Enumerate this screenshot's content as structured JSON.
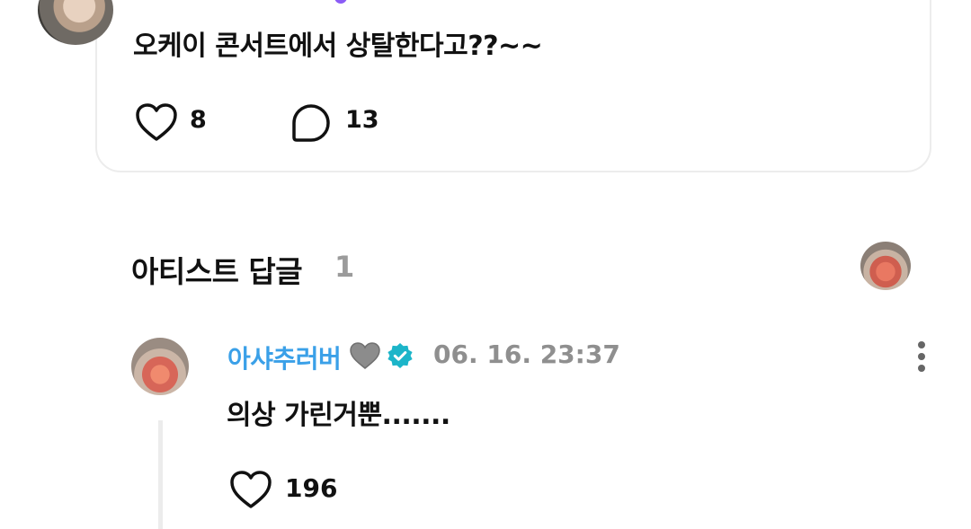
{
  "post": {
    "text": "오케이 콘서트에서 상탈한다고??~~",
    "like_count": "8",
    "comment_count": "13"
  },
  "artist_replies": {
    "title": "아티스트 답글",
    "count": "1"
  },
  "reply": {
    "author": "아샤추러버",
    "timestamp": "06. 16. 23:37",
    "text": "의상 가린거뿐.......",
    "like_count": "196"
  },
  "colors": {
    "author_name": "#3aa0e8",
    "verified_badge": "#1cb5c9",
    "muted_text": "#8f8f8f",
    "divider": "#ececec"
  },
  "icons": {
    "post_like": "heart-outline-icon",
    "post_comment": "comment-bubble-icon",
    "reply_heart_emoji": "gray-heart-icon",
    "verified": "verified-badge-icon",
    "more": "more-vertical-icon",
    "reply_like": "heart-outline-icon"
  }
}
